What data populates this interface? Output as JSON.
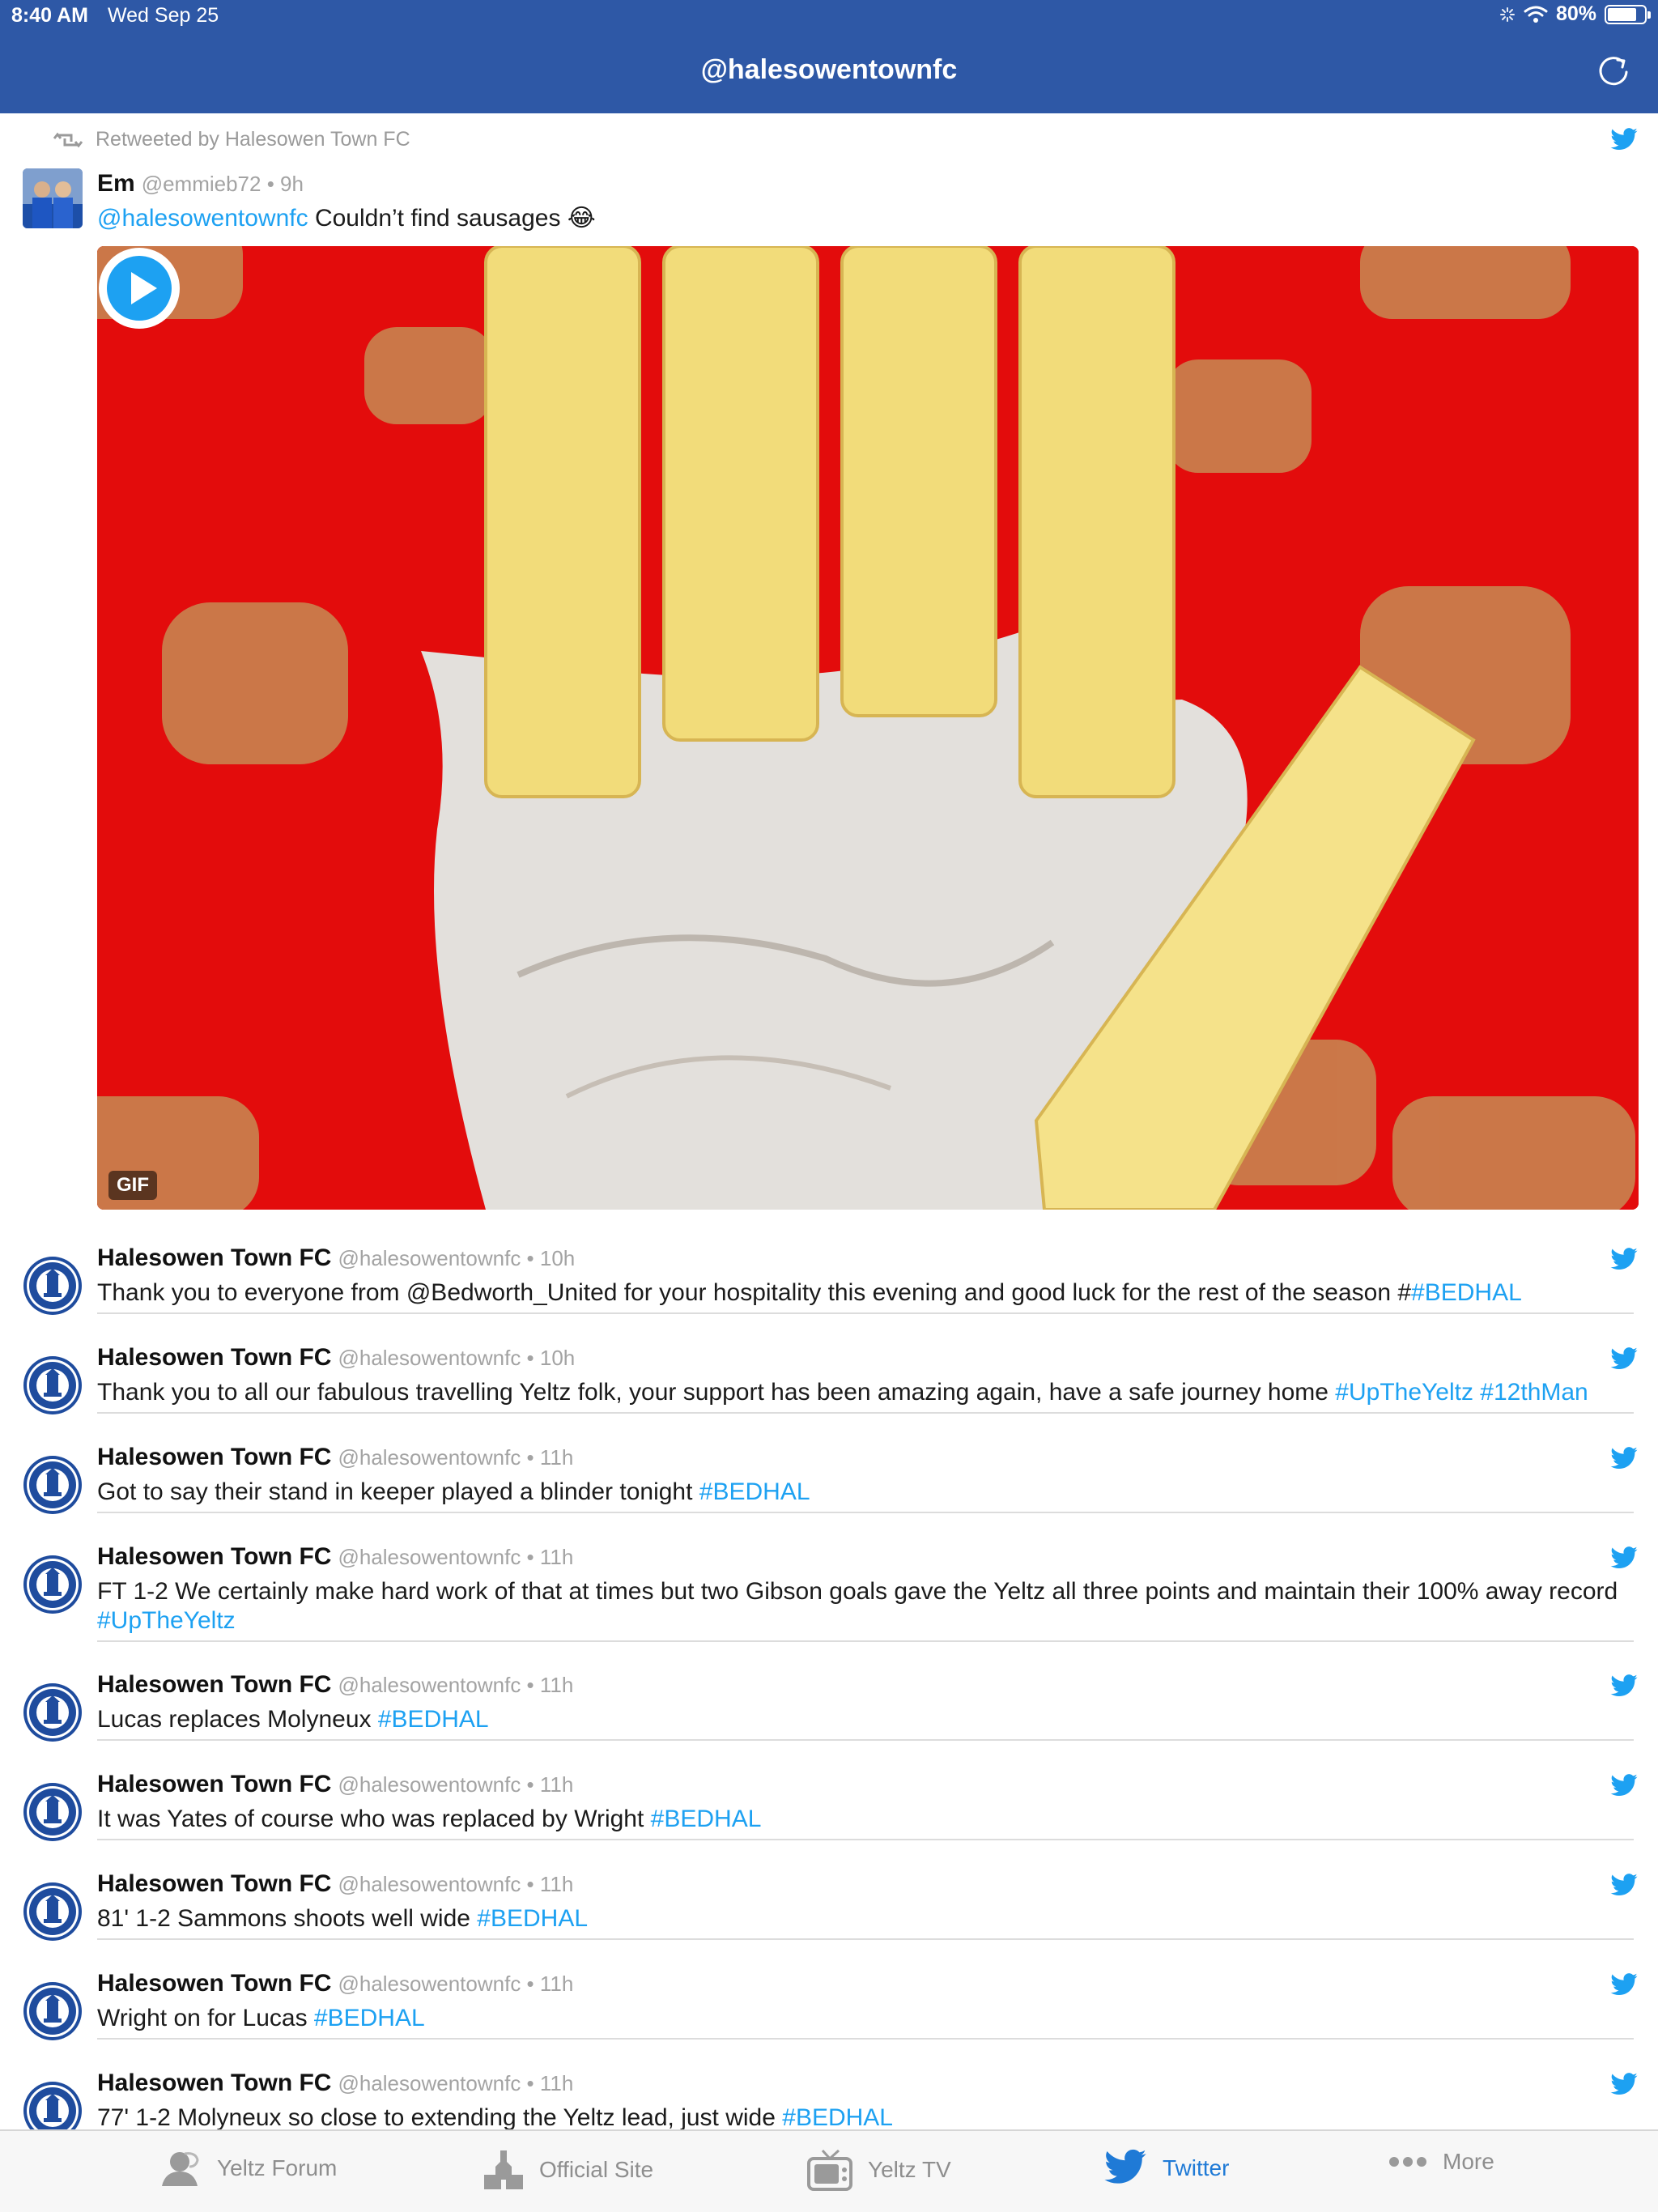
{
  "status_bar": {
    "time": "8:40 AM",
    "date": "Wed Sep 25",
    "battery": "80%",
    "battery_level": 0.8
  },
  "nav": {
    "title": "@halesowentownfc"
  },
  "retweet_label": "Retweeted by Halesowen Town FC",
  "first_tweet": {
    "name": "Em",
    "meta": "@emmieb72 • 9h",
    "mention": "@halesowentownfc",
    "text": " Couldn’t find sausages 😂",
    "media_badge": "GIF"
  },
  "tweets": [
    {
      "name": "Halesowen Town FC",
      "meta": "@halesowentownfc • 10h",
      "text": "Thank you to everyone from @Bedworth_United for your hospitality this evening and good luck for the rest of the season  #",
      "tag": "#BEDHAL"
    },
    {
      "name": "Halesowen Town FC",
      "meta": "@halesowentownfc • 10h",
      "text": "Thank you to all our fabulous travelling Yeltz folk, your support has been amazing again, have a safe journey home ",
      "tag": "#UpTheYeltz #12thMan"
    },
    {
      "name": "Halesowen Town FC",
      "meta": "@halesowentownfc • 11h",
      "text": "Got to say their stand in keeper played a blinder tonight ",
      "tag": "#BEDHAL"
    },
    {
      "name": "Halesowen Town FC",
      "meta": "@halesowentownfc • 11h",
      "text": "FT 1-2 We certainly make hard work of that at times but two Gibson goals gave the Yeltz all three points and maintain their 100% away record ",
      "tag": "#UpTheYeltz"
    },
    {
      "name": "Halesowen Town FC",
      "meta": "@halesowentownfc • 11h",
      "text": "Lucas replaces Molyneux ",
      "tag": "#BEDHAL"
    },
    {
      "name": "Halesowen Town FC",
      "meta": "@halesowentownfc • 11h",
      "text": "It was Yates of course who was replaced by Wright ",
      "tag": "#BEDHAL"
    },
    {
      "name": "Halesowen Town FC",
      "meta": "@halesowentownfc • 11h",
      "text": "81' 1-2 Sammons shoots well wide ",
      "tag": "#BEDHAL"
    },
    {
      "name": "Halesowen Town FC",
      "meta": "@halesowentownfc • 11h",
      "text": "Wright on for Lucas ",
      "tag": "#BEDHAL"
    },
    {
      "name": "Halesowen Town FC",
      "meta": "@halesowentownfc • 11h",
      "text": "77' 1-2 Molyneux so close to extending the Yeltz lead, just wide ",
      "tag": "#BEDHAL"
    }
  ],
  "tabs": [
    {
      "label": "Yeltz Forum",
      "icon": "forum-icon"
    },
    {
      "label": "Official Site",
      "icon": "church-icon"
    },
    {
      "label": "Yeltz TV",
      "icon": "tv-icon"
    },
    {
      "label": "Twitter",
      "icon": "twitter-icon",
      "active": true
    },
    {
      "label": "More",
      "icon": "more-icon"
    }
  ],
  "colors": {
    "nav": "#2e58a6",
    "link": "#1da1f2",
    "tab_active": "#1f7ad6",
    "media_bg": "#e30c0c"
  }
}
